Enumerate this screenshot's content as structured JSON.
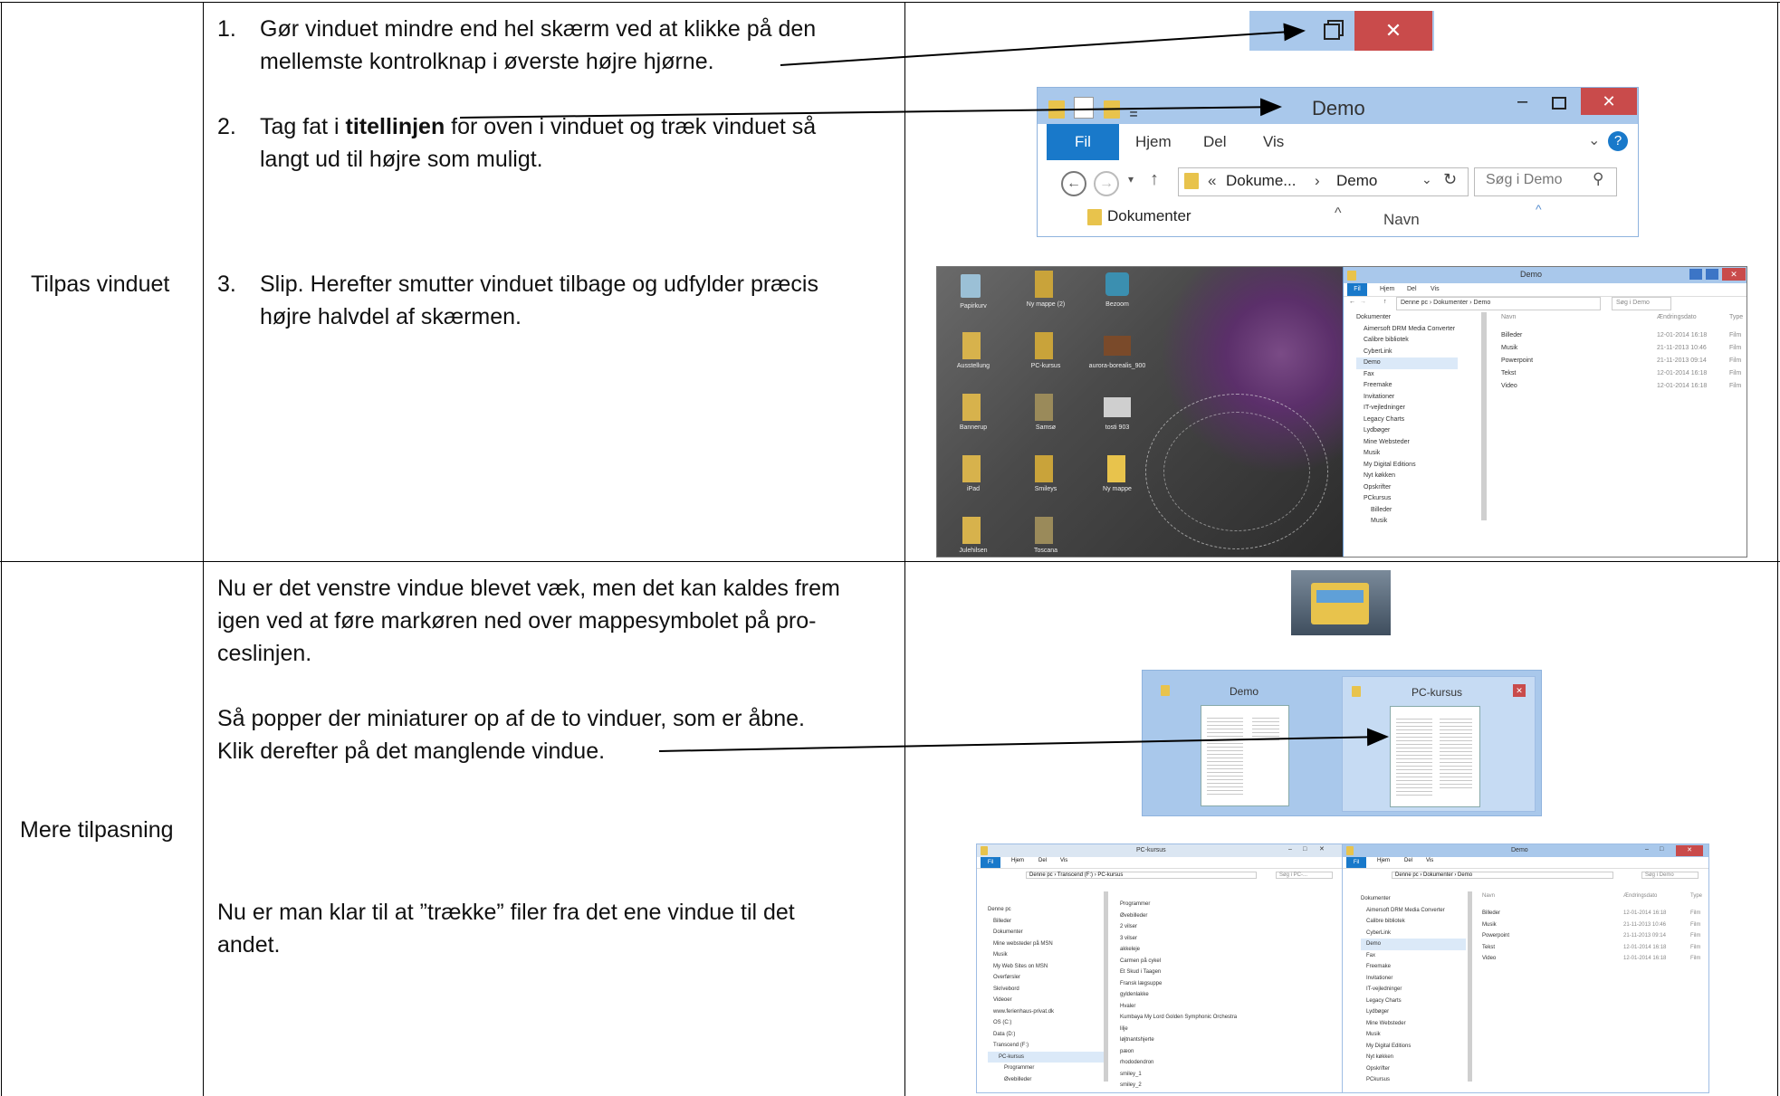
{
  "row1": {
    "label": "Tilpas vinduet",
    "step1_num": "1.",
    "step1_line1": "Gør vinduet mindre end hel skærm ved at klikke på den",
    "step1_line2": "mellemste kontrolknap i øverste højre hjørne.",
    "step2_num": "2.",
    "step2_pre": "Tag fat i ",
    "step2_bold": "titellinjen",
    "step2_post": " for oven i vinduet og træk vinduet så",
    "step2_line2": "langt ud til højre som muligt.",
    "step3_num": "3.",
    "step3_line1": "Slip. Herefter smutter vinduet tilbage og udfylder præcis",
    "step3_line2": "højre halvdel af skærmen."
  },
  "row2": {
    "label": "Mere tilpasning",
    "para1_line1": "Nu er det venstre vindue blevet væk, men det kan kaldes frem",
    "para1_line2": "igen ved at føre markøren ned over mappesymbolet på pro-",
    "para1_line3": "ceslinjen.",
    "para2_line1": "Så popper der miniaturer op af de to vinduer, som er åbne.",
    "para2_line2": "Klik derefter på det manglende vindue.",
    "para3_line1": "Nu er man klar til at ”trække” filer fra det ene vindue til det",
    "para3_line2": "andet."
  },
  "ctrl_buttons": {
    "minimize": "–",
    "restore": "🗗",
    "close": "✕"
  },
  "explorer_big": {
    "title": "Demo",
    "tabs": [
      "Fil",
      "Hjem",
      "Del",
      "Vis"
    ],
    "breadcrumb_prefix": "«",
    "breadcrumb_1": "Dokume...",
    "breadcrumb_sep": "›",
    "breadcrumb_2": "Demo",
    "search_placeholder": "Søg i Demo",
    "nav_item": "Dokumenter",
    "col_name": "Navn"
  },
  "desktop_icons": [
    "Papirkurv",
    "Ny mappe (2)",
    "Bezoom",
    "Ausstellung",
    "PC-kursus",
    "aurora-borealis_900",
    "Bannerup",
    "Samsø",
    "tosti 903",
    "iPad",
    "Smileys",
    "Ny mappe",
    "Julehilsen",
    "Toscana"
  ],
  "demo_window": {
    "title": "Demo",
    "tabs": [
      "Fil",
      "Hjem",
      "Del",
      "Vis"
    ],
    "path": "Denne pc › Dokumenter › Demo",
    "search": "Søg i Demo",
    "tree": [
      "Dokumenter",
      "Aimersoft DRM Media Converter",
      "Calibre bibliotek",
      "CyberLink",
      "Demo",
      "Fax",
      "Freemake",
      "Invitationer",
      "IT-vejledninger",
      "Legacy Charts",
      "Lydbøger",
      "Mine Websteder",
      "Musik",
      "My Digital Editions",
      "Nyt køkken",
      "Opskrifter",
      "PCkursus",
      "Billeder",
      "Musik"
    ],
    "col_name": "Navn",
    "col_date": "Ændringsdato",
    "col_type": "Type",
    "files": [
      {
        "name": "Billeder",
        "date": "12-01-2014 16:18",
        "type": "Film"
      },
      {
        "name": "Musik",
        "date": "21-11-2013 10:46",
        "type": "Film"
      },
      {
        "name": "Powerpoint",
        "date": "21-11-2013 09:14",
        "type": "Film"
      },
      {
        "name": "Tekst",
        "date": "12-01-2014 16:18",
        "type": "Film"
      },
      {
        "name": "Video",
        "date": "12-01-2014 16:18",
        "type": "Film"
      }
    ]
  },
  "thumbnails": {
    "left_title": "Demo",
    "right_title": "PC-kursus",
    "close": "✕"
  },
  "pc_window": {
    "title": "PC-kursus",
    "tabs": [
      "Fil",
      "Hjem",
      "Del",
      "Vis"
    ],
    "path": "Denne pc › Transcend (F:) › PC-kursus",
    "search": "Søg i PC-...",
    "tree": [
      "Denne pc",
      "Billeder",
      "Dokumenter",
      "Mine websteder på MSN",
      "Musik",
      "My Web Sites on MSN",
      "Overførsler",
      "Skrivebord",
      "Videoer",
      "www.ferienhaus-privat.dk",
      "OS (C:)",
      "Data (D:)",
      "Transcend (F:)",
      "PC-kursus",
      "Programmer",
      "Øvebilleder"
    ],
    "files": [
      "Programmer",
      "Øvebilleder",
      "2 vilser",
      "3 vilser",
      "akkeleje",
      "Carmen på cykel",
      "Et Skud i Taagen",
      "Fransk lægsuppe",
      "gyldenlakke",
      "Hvaler",
      "Kumbaya My Lord Golden Symphonic Orchestra",
      "lilje",
      "løjtnantshjerte",
      "pæon",
      "rhododendron",
      "smiley_1",
      "smiley_2"
    ]
  },
  "colors": {
    "accent": "#1979ca",
    "close_red": "#c94b4b",
    "titlebar": "#a9c8eb",
    "folder": "#e8c34c"
  }
}
